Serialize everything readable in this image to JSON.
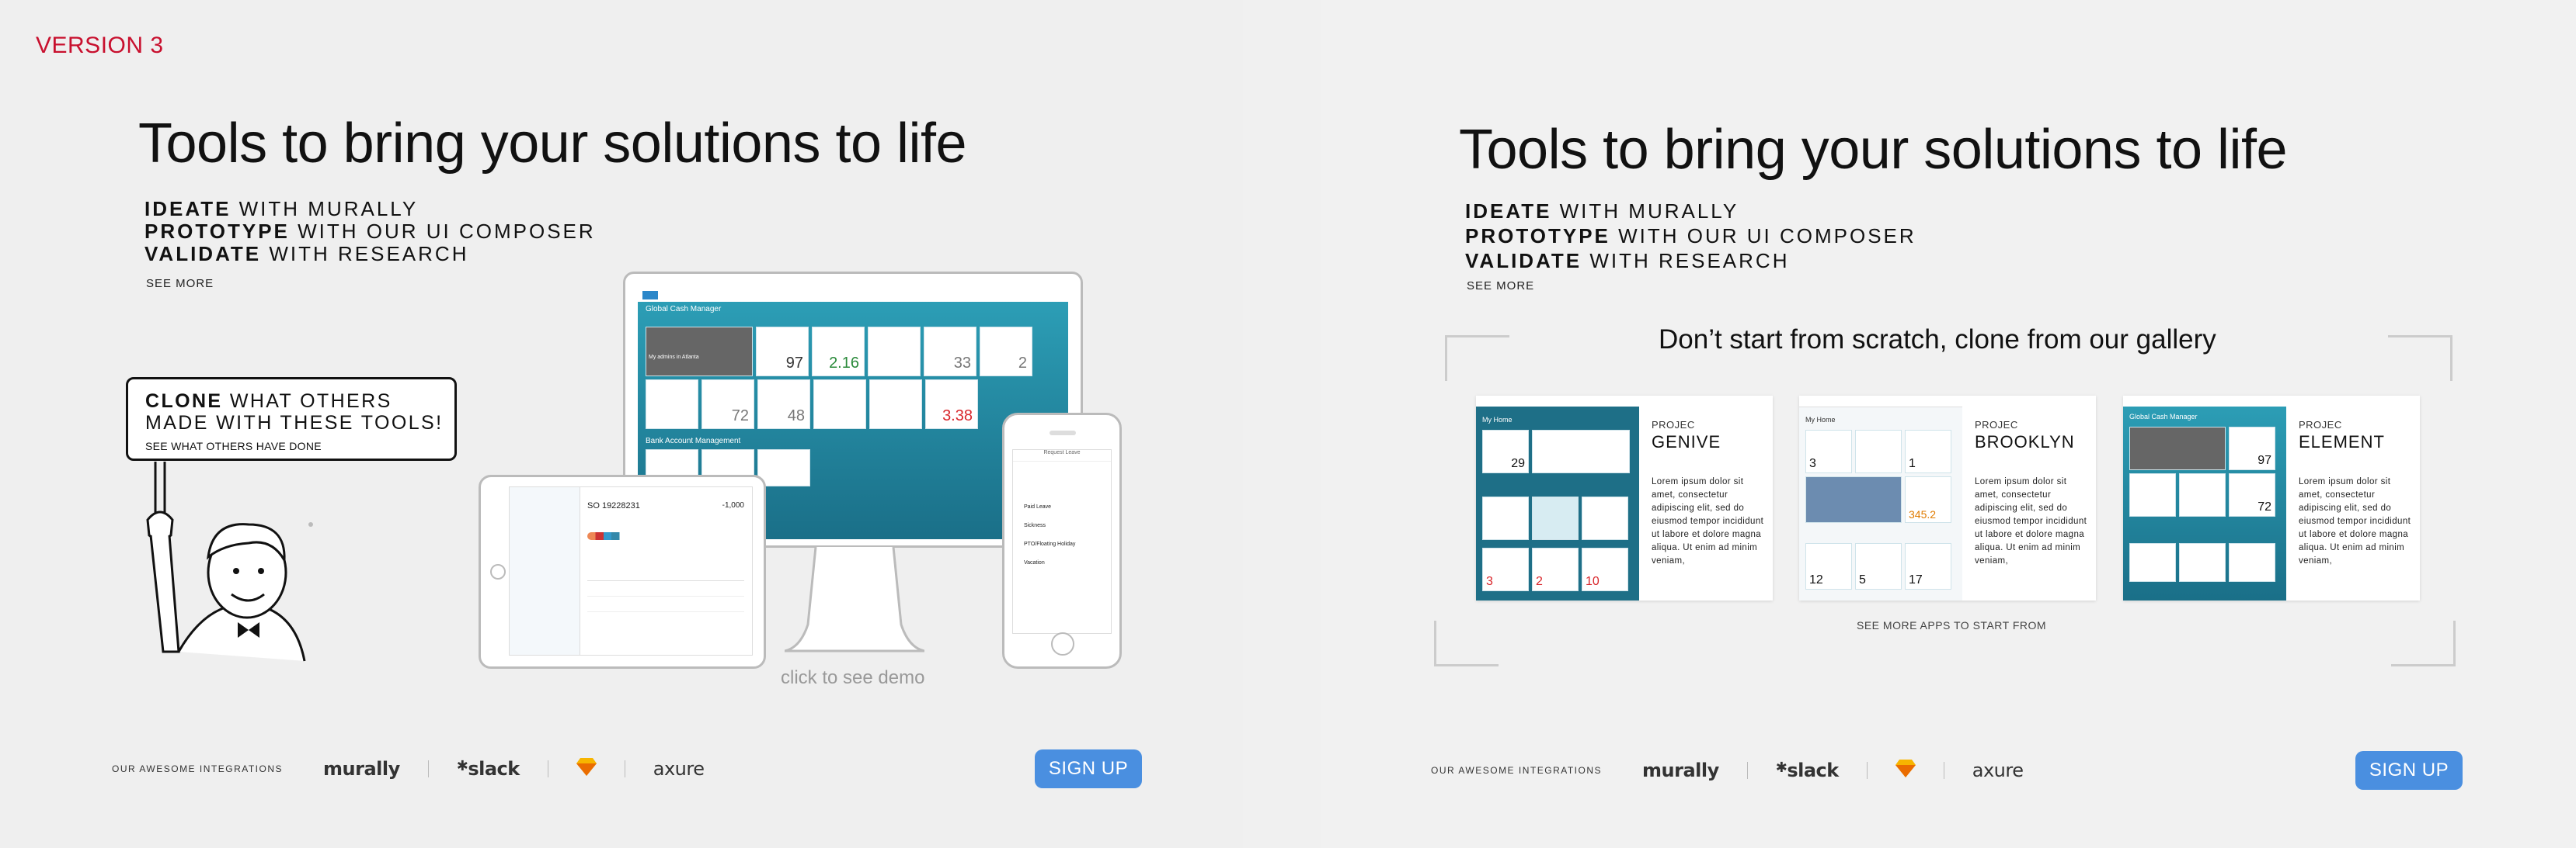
{
  "version_label": "VERSION 3",
  "headline": "Tools to bring your solutions to life",
  "taglines": [
    {
      "bold": "IDEATE",
      "rest": " WITH MURALLY"
    },
    {
      "bold": "PROTOTYPE",
      "rest": " WITH OUR UI COMPOSER"
    },
    {
      "bold": "VALIDATE",
      "rest": " WITH RESEARCH"
    }
  ],
  "see_more": "SEE MORE",
  "clone_box": {
    "bold": "CLONE",
    "rest1": " WHAT OTHERS",
    "line2": "MADE WITH THESE TOOLS!",
    "sub": "SEE WHAT OTHERS HAVE DONE"
  },
  "demo_link": "click to see demo",
  "integrations_label": "OUR AWESOME INTEGRATIONS",
  "integrations": [
    "murally",
    "slack",
    "sketch",
    "axure"
  ],
  "signup_label": "SIGN UP",
  "desktop_screen": {
    "title": "Global Cash Manager",
    "section": "Bank Account Management",
    "kpis": [
      "97",
      "2.16",
      "33",
      "2",
      "72",
      "48",
      "3.38"
    ],
    "tile_caption": "My admins in Atlanta"
  },
  "tablet_screen": {
    "order": "SO 19228231",
    "amount": "-1,000"
  },
  "phone_screen": {
    "title": "Request Leave",
    "options": [
      "Paid Leave",
      "Sickness",
      "PTO/Floating Holiday",
      "Vacation"
    ]
  },
  "gallery": {
    "title": "Don’t start from scratch, clone from our gallery",
    "see_more_apps": "SEE MORE APPS TO START FROM",
    "projects": [
      {
        "prefix": "PROJEC",
        "name": "GENIVE",
        "lorem": "Lorem ipsum dolor sit amet, consectetur adipiscing elit, sed do eiusmod tempor incididunt ut labore et dolore magna aliqua. Ut enim ad minim veniam,",
        "kpis": [
          "29",
          "3",
          "2",
          "10"
        ],
        "screen_title": "My Home"
      },
      {
        "prefix": "PROJEC",
        "name": "BROOKLYN",
        "lorem": "Lorem ipsum dolor sit amet, consectetur adipiscing elit, sed do eiusmod tempor incididunt ut labore et dolore magna aliqua. Ut enim ad minim veniam,",
        "kpis": [
          "3",
          "1",
          "345.2",
          "12",
          "5",
          "17"
        ],
        "screen_title": "My Home"
      },
      {
        "prefix": "PROJEC",
        "name": "ELEMENT",
        "lorem": "Lorem ipsum dolor sit amet, consectetur adipiscing elit, sed do eiusmod tempor incididunt ut labore et dolore magna aliqua. Ut enim ad minim veniam,",
        "kpis": [
          "97",
          "72"
        ],
        "screen_title": "Global Cash Manager"
      }
    ]
  },
  "colors": {
    "accent": "#4a8fe0",
    "version_red": "#c8102e",
    "teal": "#1a7f95"
  }
}
